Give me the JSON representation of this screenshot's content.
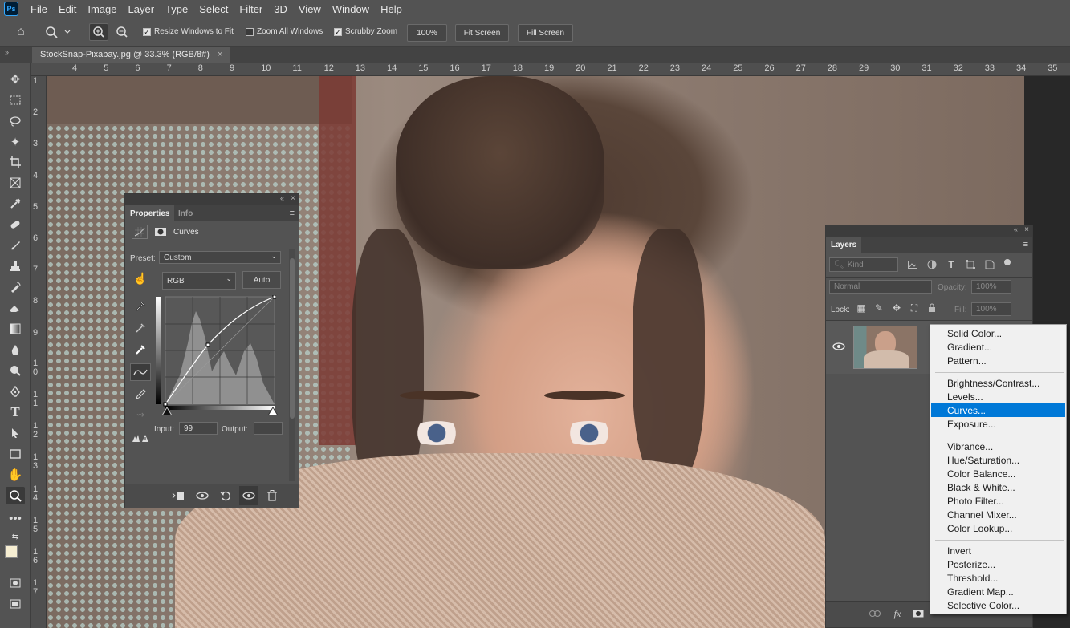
{
  "menubar": {
    "logo": "Ps",
    "items": [
      "File",
      "Edit",
      "Image",
      "Layer",
      "Type",
      "Select",
      "Filter",
      "3D",
      "View",
      "Window",
      "Help"
    ]
  },
  "options": {
    "resize_windows": "Resize Windows to Fit",
    "zoom_all": "Zoom All Windows",
    "scrubby_zoom": "Scrubby Zoom",
    "zoom_100": "100%",
    "fit_screen": "Fit Screen",
    "fill_screen": "Fill Screen"
  },
  "document_tab": {
    "title": "StockSnap-Pixabay.jpg @ 33.3% (RGB/8#)",
    "close": "×"
  },
  "ruler_top": [
    "4",
    "5",
    "6",
    "7",
    "8",
    "9",
    "10",
    "11",
    "12",
    "13",
    "14",
    "15",
    "16",
    "17",
    "18",
    "19",
    "20",
    "21",
    "22",
    "23",
    "24",
    "25",
    "26",
    "27",
    "28",
    "29",
    "30",
    "31",
    "32",
    "33",
    "34",
    "35"
  ],
  "ruler_left": [
    "1",
    "2",
    "3",
    "4",
    "5",
    "6",
    "7",
    "8",
    "9",
    "1 0",
    "1 1",
    "1 2",
    "1 3",
    "1 4",
    "1 5",
    "1 6",
    "1 7"
  ],
  "properties": {
    "tab_active": "Properties",
    "tab_inactive": "Info",
    "type": "Curves",
    "preset_label": "Preset:",
    "preset_value": "Custom",
    "channel": "RGB",
    "auto": "Auto",
    "input_label": "Input:",
    "input_value": "99",
    "output_label": "Output:",
    "output_value": ""
  },
  "layers": {
    "title": "Layers",
    "kind": "Kind",
    "blend": "Normal",
    "opacity_label": "Opacity:",
    "opacity_value": "100%",
    "lock_label": "Lock:",
    "fill_label": "Fill:",
    "fill_value": "100%"
  },
  "adjustment_menu": {
    "group1": [
      "Solid Color...",
      "Gradient...",
      "Pattern..."
    ],
    "group2": [
      "Brightness/Contrast...",
      "Levels...",
      "Curves...",
      "Exposure..."
    ],
    "group3": [
      "Vibrance...",
      "Hue/Saturation...",
      "Color Balance...",
      "Black & White...",
      "Photo Filter...",
      "Channel Mixer...",
      "Color Lookup..."
    ],
    "group4": [
      "Invert",
      "Posterize...",
      "Threshold...",
      "Gradient Map...",
      "Selective Color..."
    ],
    "highlighted": "Curves..."
  },
  "colors": {
    "ui_panel": "#535353",
    "highlight": "#0078d7",
    "menu_bg": "#f0f0f0"
  }
}
